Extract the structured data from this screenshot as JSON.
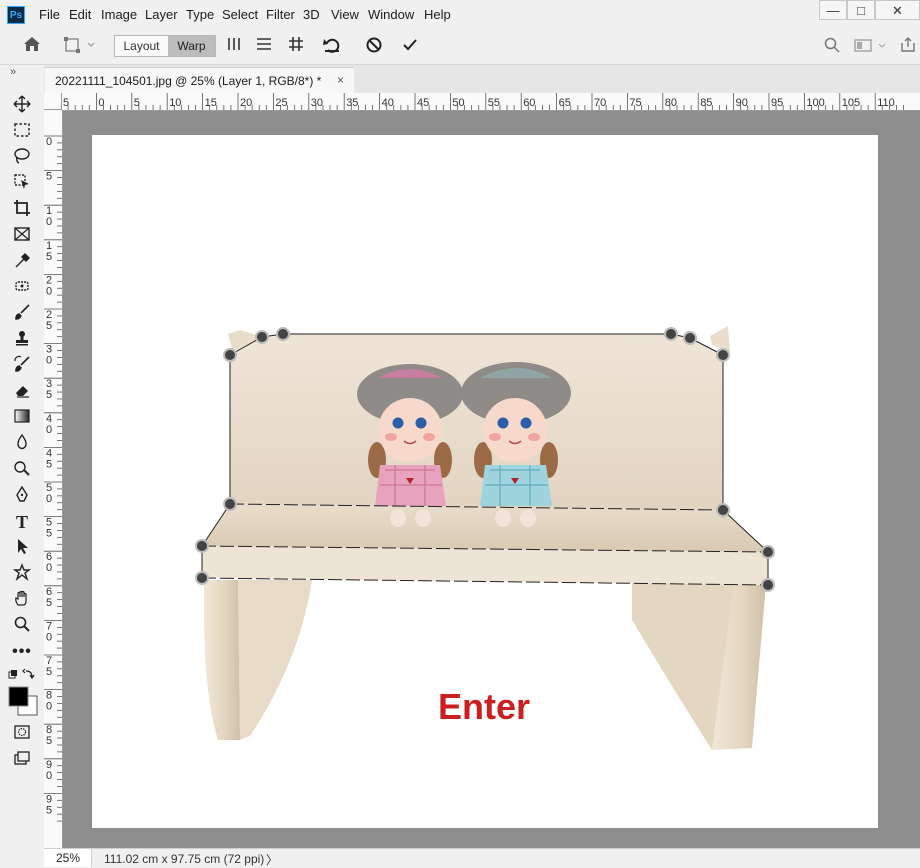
{
  "app": {
    "logo_text": "Ps"
  },
  "menu": [
    "File",
    "Edit",
    "Image",
    "Layer",
    "Type",
    "Select",
    "Filter",
    "3D",
    "View",
    "Window",
    "Help"
  ],
  "window_controls": {
    "minimize": "—",
    "maximize": "□",
    "close": "✕"
  },
  "options": {
    "layout_label": "Layout",
    "warp_label": "Warp",
    "active_mode": "Warp"
  },
  "document_tab": {
    "title": "20221111_104501.jpg @ 25% (Layer 1, RGB/8*) *",
    "close": "×"
  },
  "toolbar_collapse": "»",
  "rulers": {
    "horizontal": [
      "5",
      "0",
      "5",
      "10",
      "15",
      "20",
      "25",
      "30",
      "35",
      "40",
      "45",
      "50",
      "55",
      "60",
      "65",
      "70",
      "75",
      "80",
      "85",
      "90",
      "95",
      "100",
      "105",
      "110"
    ],
    "vertical": [
      "0",
      "5",
      "10",
      "15",
      "20",
      "25",
      "30",
      "35",
      "40",
      "45",
      "50",
      "55",
      "60",
      "65",
      "70",
      "75",
      "80",
      "85",
      "90",
      "95"
    ]
  },
  "status": {
    "zoom": "25%",
    "doc_info": "111.02 cm x 97.75 cm (72 ppi)",
    "arrow": "〉"
  },
  "annotation": {
    "text": "Enter",
    "color": "#cc1f1f"
  },
  "colors": {
    "pasteboard": "#8e8e8e",
    "wood": "#e6d9c8",
    "accent": "#31a8ff"
  },
  "icons": {
    "tools": [
      "move-icon",
      "marquee-icon",
      "lasso-icon",
      "object-select-icon",
      "crop-icon",
      "frame-icon",
      "eyedropper-icon",
      "healing-icon",
      "brush-icon",
      "stamp-icon",
      "history-brush-icon",
      "eraser-icon",
      "gradient-icon",
      "blur-icon",
      "dodge-icon",
      "pen-icon",
      "type-icon",
      "path-select-icon",
      "shape-icon",
      "hand-icon",
      "zoom-icon",
      "more-icon"
    ],
    "options": [
      "home-icon",
      "transform-icon",
      "split-vertical-icon",
      "split-horizontal-icon",
      "split-cross-icon",
      "undo-warp-icon",
      "cancel-icon",
      "commit-icon",
      "search-icon",
      "workspace-icon",
      "share-icon"
    ]
  }
}
